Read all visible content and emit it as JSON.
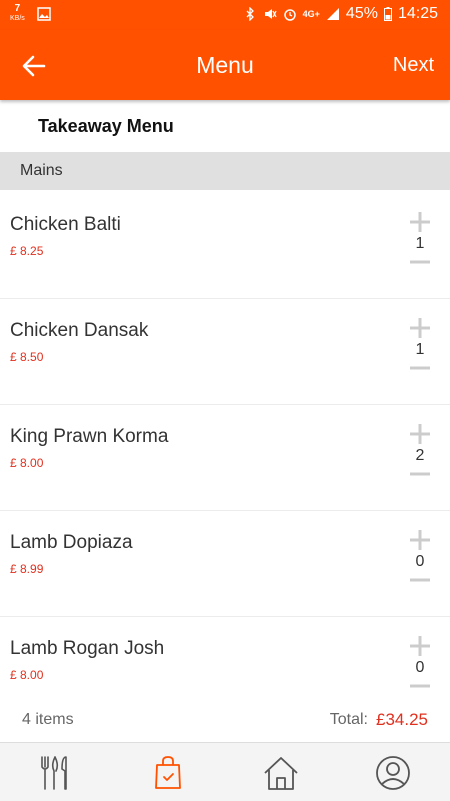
{
  "status_bar": {
    "net_speed_value": "7",
    "net_speed_unit": "KB/s",
    "network": "4G+",
    "battery": "45%",
    "time": "14:25"
  },
  "app_bar": {
    "title": "Menu",
    "next_label": "Next"
  },
  "menu": {
    "title": "Takeaway Menu",
    "section": "Mains",
    "items": [
      {
        "name": "Chicken Balti",
        "price": "£ 8.25",
        "qty": "1"
      },
      {
        "name": "Chicken Dansak",
        "price": "£ 8.50",
        "qty": "1"
      },
      {
        "name": "King Prawn Korma",
        "price": "£ 8.00",
        "qty": "2"
      },
      {
        "name": "Lamb Dopiaza",
        "price": "£ 8.99",
        "qty": "0"
      },
      {
        "name": "Lamb Rogan Josh",
        "price": "£ 8.00",
        "qty": "0"
      }
    ]
  },
  "summary": {
    "items_count": "4 items",
    "total_label": "Total:",
    "total_value": "£34.25"
  },
  "colors": {
    "brand": "#ff5100",
    "price": "#e0301e",
    "section_bg": "#e0e0e0"
  },
  "bottom_nav": [
    "utensils-icon",
    "shopping-bag-icon",
    "home-icon",
    "profile-icon"
  ]
}
